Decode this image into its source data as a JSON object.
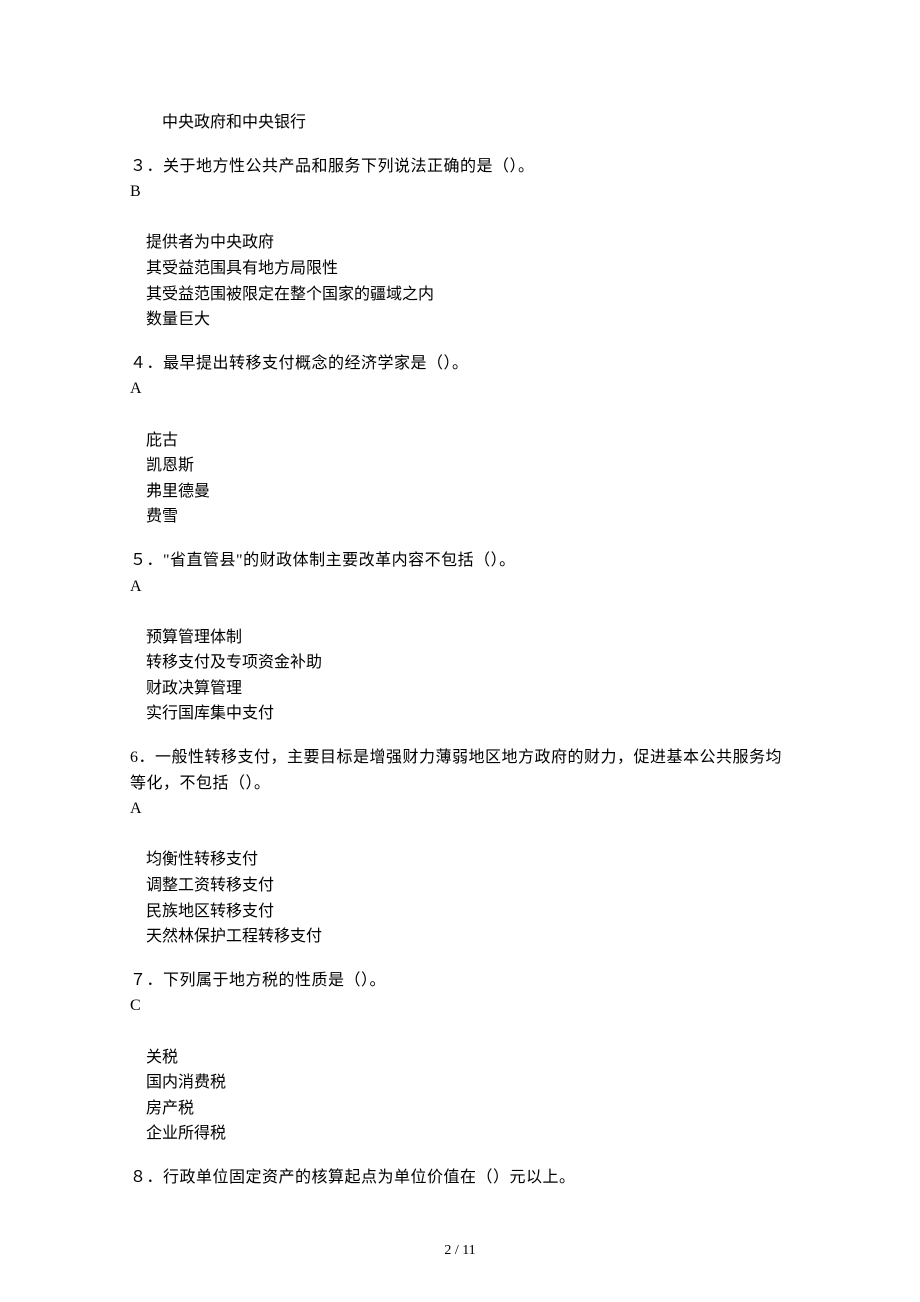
{
  "top_line": "中央政府和中央银行",
  "questions": [
    {
      "num": "３．",
      "stem": "关于地方性公共产品和服务下列说法正确的是（）。",
      "answer": "B",
      "options": [
        "提供者为中央政府",
        "其受益范围具有地方局限性",
        "其受益范围被限定在整个国家的疆域之内",
        "数量巨大"
      ]
    },
    {
      "num": "４．",
      "stem": "最早提出转移支付概念的经济学家是（）。",
      "answer": "A",
      "options": [
        "庇古",
        "凯恩斯",
        "弗里德曼",
        "费雪"
      ]
    },
    {
      "num": "５．",
      "stem": "\"省直管县\"的财政体制主要改革内容不包括（）。",
      "answer": "A",
      "options": [
        "预算管理体制",
        "转移支付及专项资金补助",
        "财政决算管理",
        "实行国库集中支付"
      ]
    },
    {
      "num": "6．",
      "stem": "一般性转移支付，主要目标是增强财力薄弱地区地方政府的财力，促进基本公共服务均等化，不包括（）。",
      "answer": "A",
      "options": [
        "均衡性转移支付",
        "调整工资转移支付",
        "民族地区转移支付",
        "天然林保护工程转移支付"
      ]
    },
    {
      "num": "７．",
      "stem": "下列属于地方税的性质是（）。",
      "answer": "C",
      "options": [
        "关税",
        "国内消费税",
        "房产税",
        "企业所得税"
      ]
    },
    {
      "num": "８．",
      "stem": "行政单位固定资产的核算起点为单位价值在（）元以上。",
      "answer": "",
      "options": []
    }
  ],
  "page_number": "2 / 11"
}
